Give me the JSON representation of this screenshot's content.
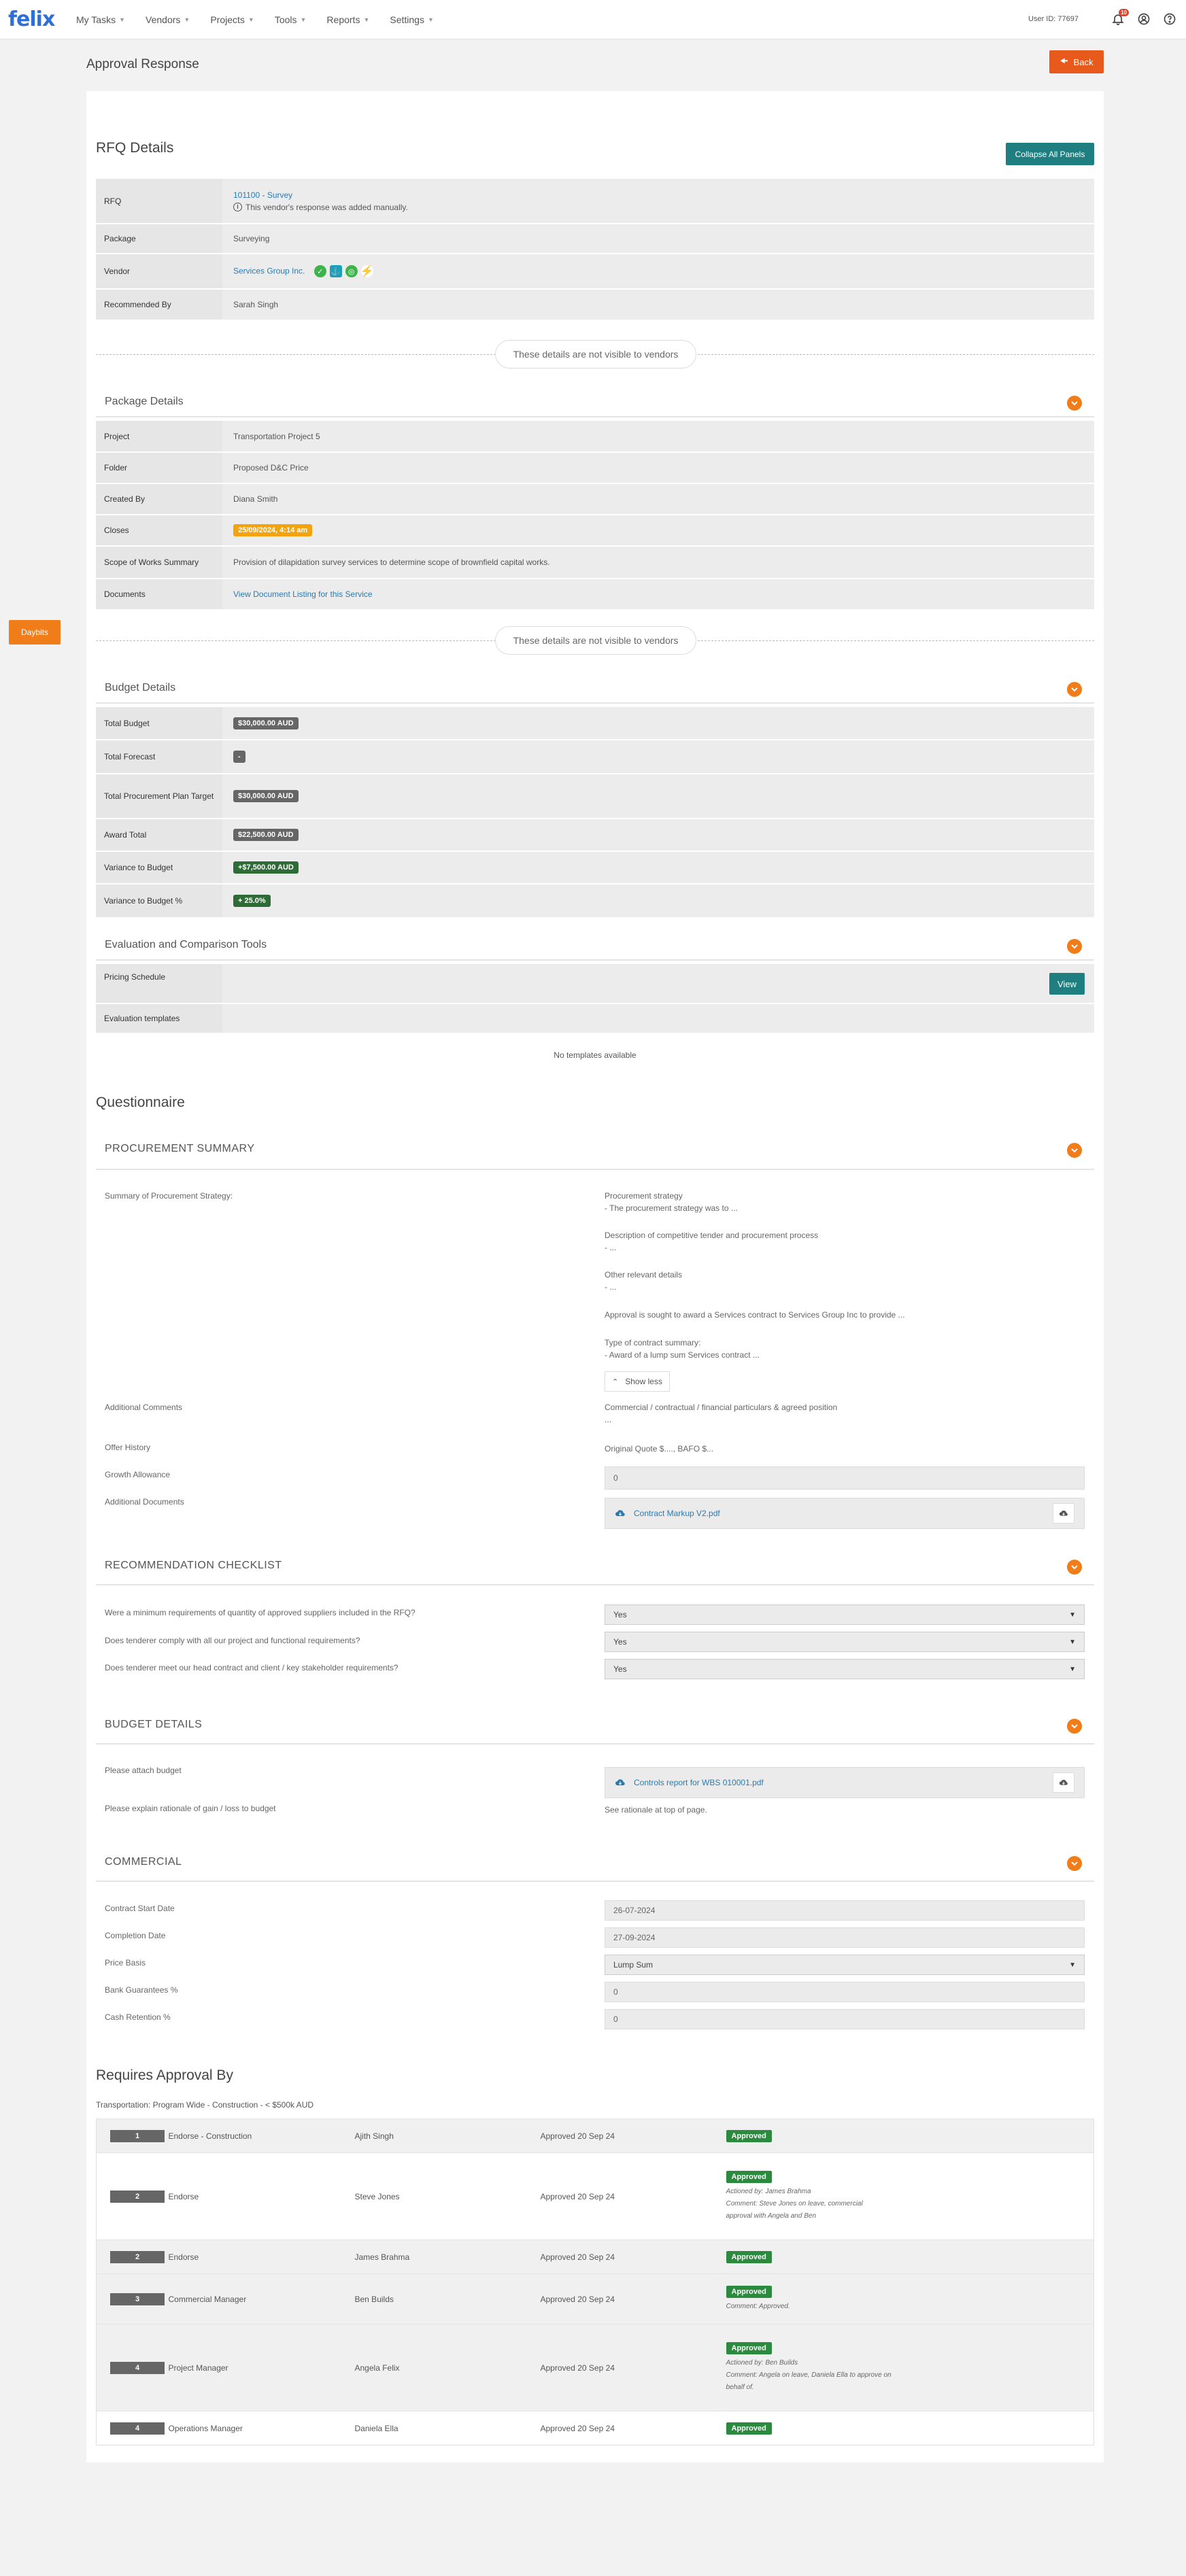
{
  "nav": {
    "logo": "felix",
    "items": [
      {
        "label": "My Tasks"
      },
      {
        "label": "Vendors"
      },
      {
        "label": "Projects"
      },
      {
        "label": "Tools"
      },
      {
        "label": "Reports"
      },
      {
        "label": "Settings"
      }
    ],
    "user_id": "User ID: 77697",
    "notification_count": "10"
  },
  "side_tab": {
    "label": "Daybits"
  },
  "header": {
    "title": "Approval Response",
    "back_label": "Back"
  },
  "rfq": {
    "title": "RFQ Details",
    "collapse_label": "Collapse All Panels",
    "rows": {
      "rfq_label": "RFQ",
      "rfq_link": "101100 - Survey",
      "rfq_note": "This vendor's response was added manually.",
      "package_label": "Package",
      "package_value": "Surveying",
      "vendor_label": "Vendor",
      "vendor_value": "Services Group Inc.",
      "recommended_label": "Recommended By",
      "recommended_value": "Sarah Singh"
    }
  },
  "not_visible_label": "These details are not visible to vendors",
  "package_details": {
    "title": "Package Details",
    "project_label": "Project",
    "project_value": "Transportation Project 5",
    "folder_label": "Folder",
    "folder_value": "Proposed D&C Price",
    "created_label": "Created By",
    "created_value": "Diana Smith",
    "closes_label": "Closes",
    "closes_value": "25/09/2024, 4:14 am",
    "scope_label": "Scope of Works Summary",
    "scope_value": "Provision of dilapidation survey services to determine scope of brownfield capital works.",
    "documents_label": "Documents",
    "documents_value": "View Document Listing for this Service"
  },
  "budget_details": {
    "title": "Budget Details",
    "rows": [
      {
        "label": "Total Budget",
        "value": "$30,000.00 AUD",
        "style": "grey"
      },
      {
        "label": "Total Forecast",
        "value": "-",
        "style": "grey"
      },
      {
        "label": "Total Procurement Plan Target",
        "value": "$30,000.00 AUD",
        "style": "grey"
      },
      {
        "label": "Award Total",
        "value": "$22,500.00 AUD",
        "style": "grey"
      },
      {
        "label": "Variance to Budget",
        "value": "+$7,500.00 AUD",
        "style": "green"
      },
      {
        "label": "Variance to Budget %",
        "value": "+ 25.0%",
        "style": "green"
      }
    ]
  },
  "evaluation": {
    "title": "Evaluation and Comparison Tools",
    "pricing_label": "Pricing Schedule",
    "view_label": "View",
    "templates_label": "Evaluation templates",
    "no_templates": "No templates available"
  },
  "questionnaire": {
    "title": "Questionnaire",
    "procurement": {
      "title": "PROCUREMENT SUMMARY",
      "summary_label": "Summary of Procurement Strategy:",
      "strategy_h": "Procurement strategy",
      "strategy_v": "- The procurement strategy was to ...",
      "desc_h": "Description of competitive tender and procurement process",
      "desc_v": "- ...",
      "other_h": "Other relevant details",
      "other_v": "- ...",
      "approval_text": "Approval is sought to award a Services contract to Services Group Inc to provide ...",
      "type_h": "Type of contract summary:",
      "type_v": "- Award of a lump sum Services contract ...",
      "show_less": "Show less",
      "additional_comments_label": "Additional Comments",
      "additional_comments_h": "Commercial / contractual / financial particulars & agreed position",
      "additional_comments_v": "...",
      "offer_label": "Offer History",
      "offer_value": "Original Quote $...., BAFO $...",
      "growth_label": "Growth Allowance",
      "growth_value": "0",
      "docs_label": "Additional Documents",
      "docs_file": "Contract Markup V2.pdf"
    },
    "checklist": {
      "title": "RECOMMENDATION CHECKLIST",
      "items": [
        {
          "q": "Were a minimum requirements of quantity of approved suppliers included in the RFQ?",
          "a": "Yes"
        },
        {
          "q": "Does tenderer comply with all our project and functional requirements?",
          "a": "Yes"
        },
        {
          "q": "Does tenderer meet our head contract and client / key stakeholder requirements?",
          "a": "Yes"
        }
      ]
    },
    "budget": {
      "title": "BUDGET DETAILS",
      "attach_label": "Please attach budget",
      "attach_file": "Controls report for WBS 010001.pdf",
      "rationale_label": "Please explain rationale of gain / loss to budget",
      "rationale_value": "See rationale at top of page."
    },
    "commercial": {
      "title": "COMMERCIAL",
      "start_label": "Contract Start Date",
      "start_value": "26-07-2024",
      "completion_label": "Completion Date",
      "completion_value": "27-09-2024",
      "price_label": "Price Basis",
      "price_value": "Lump Sum",
      "bank_label": "Bank Guarantees %",
      "bank_value": "0",
      "cash_label": "Cash Retention %",
      "cash_value": "0"
    }
  },
  "approvals": {
    "title": "Requires Approval By",
    "subtitle": "Transportation: Program Wide - Construction - < $500k AUD",
    "rows": [
      {
        "step": "1",
        "role": "Endorse - Construction",
        "name": "Ajith Singh",
        "date": "Approved 20 Sep 24",
        "status": "Approved",
        "actioned": "",
        "comment": ""
      },
      {
        "step": "2",
        "role": "Endorse",
        "name": "Steve Jones",
        "date": "Approved 20 Sep 24",
        "status": "Approved",
        "actioned": "Actioned by: James Brahma",
        "comment": "Comment: Steve Jones on leave, commercial approval with Angela and Ben"
      },
      {
        "step": "2",
        "role": "Endorse",
        "name": "James Brahma",
        "date": "Approved 20 Sep 24",
        "status": "Approved",
        "actioned": "",
        "comment": ""
      },
      {
        "step": "3",
        "role": "Commercial Manager",
        "name": "Ben Builds",
        "date": "Approved 20 Sep 24",
        "status": "Approved",
        "actioned": "",
        "comment": "Comment: Approved."
      },
      {
        "step": "4",
        "role": "Project Manager",
        "name": "Angela Felix",
        "date": "Approved 20 Sep 24",
        "status": "Approved",
        "actioned": "Actioned by: Ben Builds",
        "comment": "Comment: Angela on leave, Daniela Ella to approve on behalf of."
      },
      {
        "step": "4",
        "role": "Operations Manager",
        "name": "Daniela Ella",
        "date": "Approved 20 Sep 24",
        "status": "Approved",
        "actioned": "",
        "comment": ""
      }
    ]
  },
  "colors": {
    "accent": "#f07d1a",
    "teal": "#1f7f80",
    "back": "#e8591c",
    "approved": "#2b8a3e"
  }
}
